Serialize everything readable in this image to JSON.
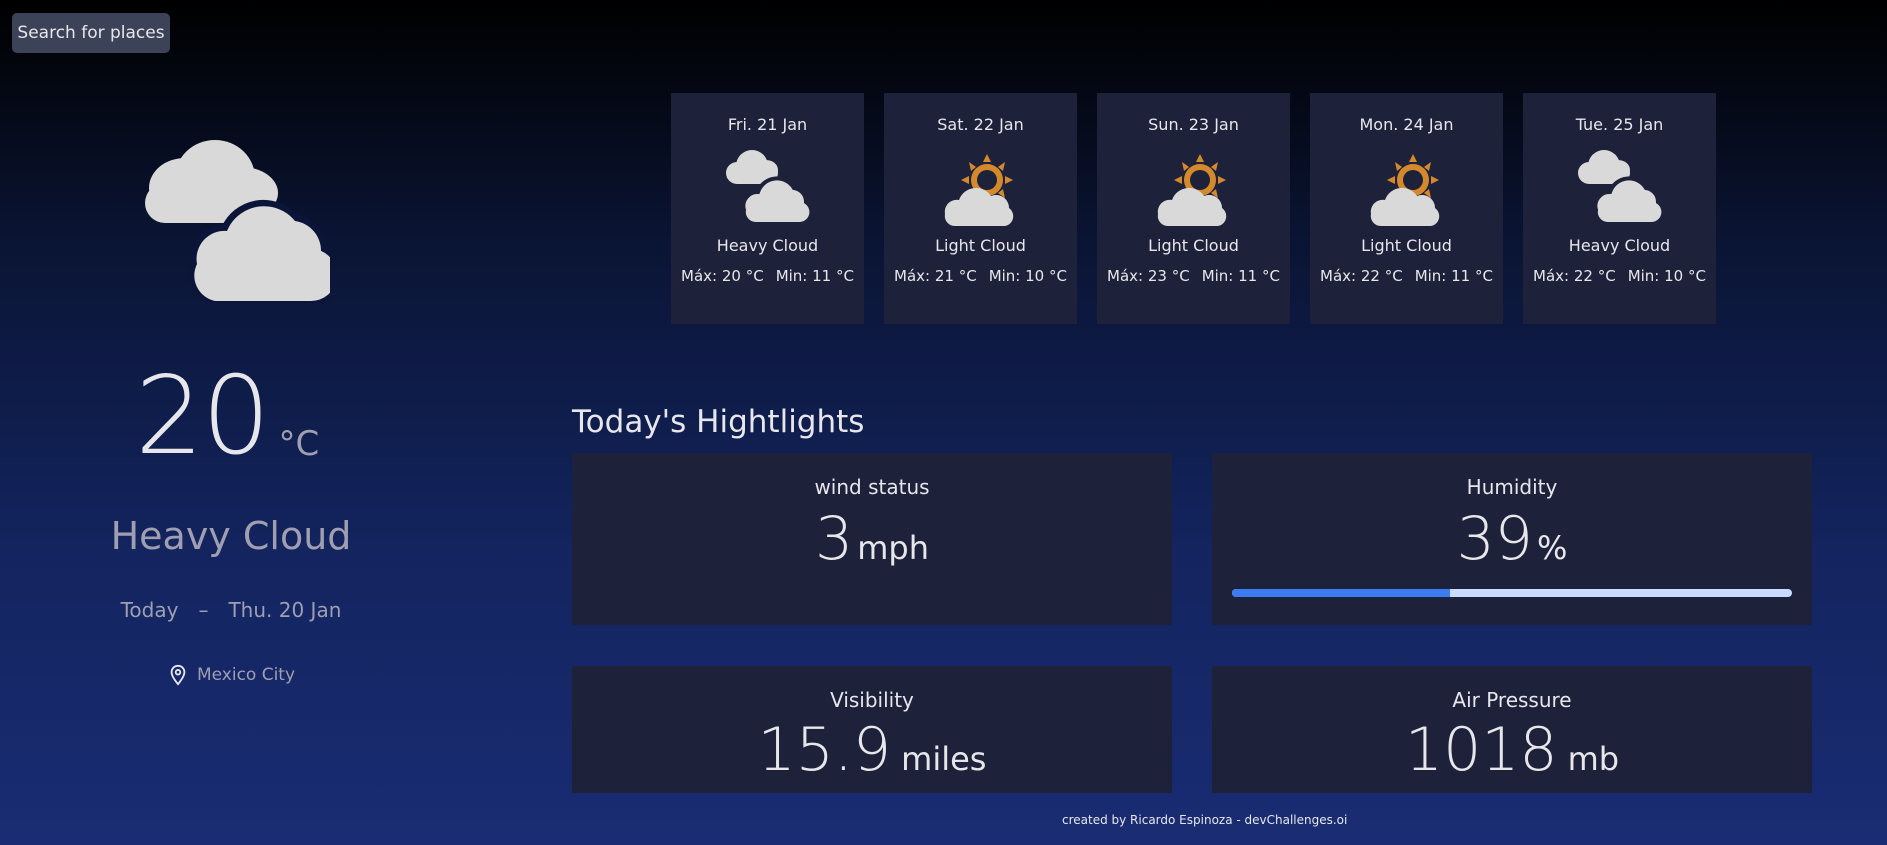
{
  "search": {
    "label": "Search for places"
  },
  "today": {
    "temp": "20",
    "unit": "°C",
    "condition": "Heavy Cloud",
    "today_label": "Today",
    "separator": "–",
    "date": "Thu. 20 Jan",
    "location": "Mexico City",
    "icon": "heavy-cloud-icon"
  },
  "forecast": [
    {
      "day": "Fri. 21 Jan",
      "condition": "Heavy Cloud",
      "max": "Máx: 20 °C",
      "min": "Min: 11 °C",
      "icon": "heavy-cloud-icon"
    },
    {
      "day": "Sat. 22 Jan",
      "condition": "Light Cloud",
      "max": "Máx: 21 °C",
      "min": "Min: 10 °C",
      "icon": "light-cloud-icon"
    },
    {
      "day": "Sun. 23 Jan",
      "condition": "Light Cloud",
      "max": "Máx: 23 °C",
      "min": "Min: 11 °C",
      "icon": "light-cloud-icon"
    },
    {
      "day": "Mon. 24 Jan",
      "condition": "Light Cloud",
      "max": "Máx: 22 °C",
      "min": "Min: 11 °C",
      "icon": "light-cloud-icon"
    },
    {
      "day": "Tue. 25 Jan",
      "condition": "Heavy Cloud",
      "max": "Máx: 22 °C",
      "min": "Min: 10 °C",
      "icon": "heavy-cloud-icon"
    }
  ],
  "highlights": {
    "title": "Today's Hightlights",
    "wind": {
      "label": "wind status",
      "value": "3",
      "unit": "mph"
    },
    "humidity": {
      "label": "Humidity",
      "value": "39",
      "unit": "%",
      "percent": 39
    },
    "visibility": {
      "label": "Visibility",
      "value": "15.9",
      "unit": "miles"
    },
    "pressure": {
      "label": "Air Pressure",
      "value": "1018",
      "unit": "mb"
    }
  },
  "footer": {
    "text": "created by Ricardo Espinoza - devChallenges.oi"
  },
  "colors": {
    "card": "#1e213a",
    "accent": "#3c7cf0",
    "sun": "#d48a2c",
    "cloud": "#d9d9d9"
  }
}
